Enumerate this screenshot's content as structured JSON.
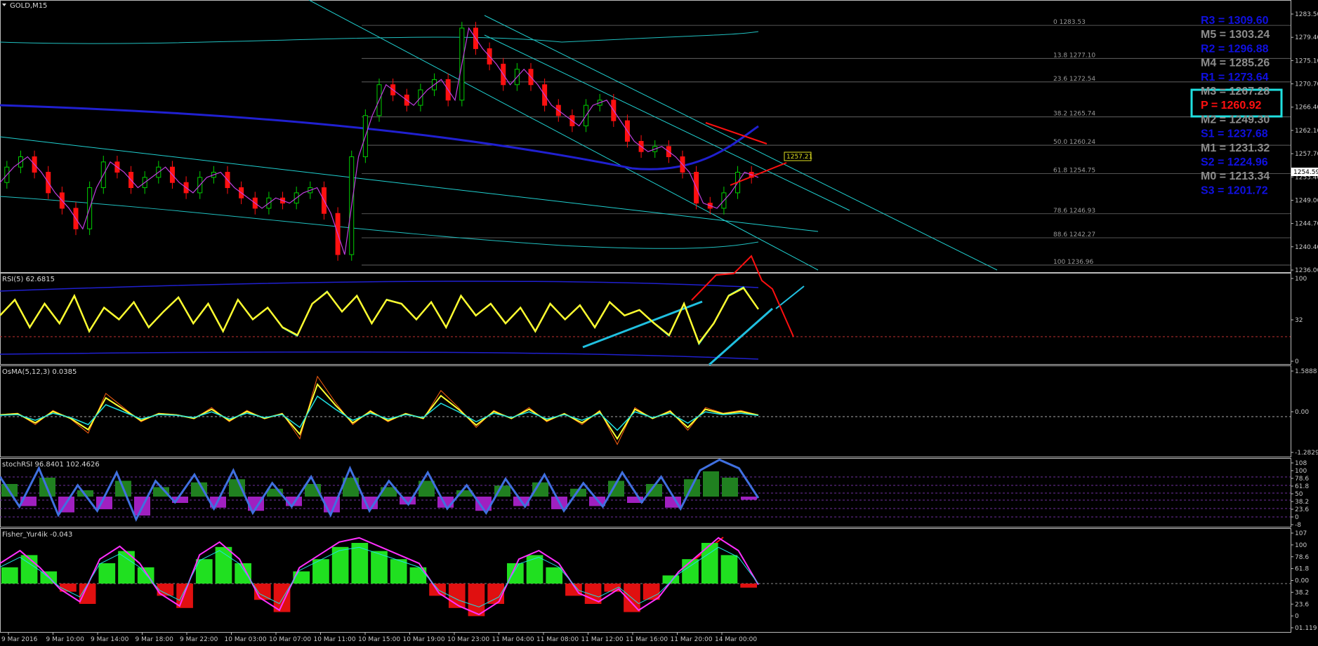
{
  "window": {
    "symbol_title": "GOLD,M15"
  },
  "chart_data": [
    {
      "type": "line",
      "name_label": "GOLD,M15",
      "ylim": [
        1236.0,
        1286.0
      ],
      "y_ticks": [
        "1283.50",
        "1279.40",
        "1275.10",
        "1270.70",
        "1266.40",
        "1262.10",
        "1257.70",
        "1253.40",
        "1249.00",
        "1244.70",
        "1240.40",
        "1236.00"
      ],
      "current_price": "1254.59",
      "price_tag": "1257.21",
      "fib_levels": [
        {
          "label": "0 1283.53",
          "value": 1283.53
        },
        {
          "label": "13.8 1277.10",
          "value": 1277.1
        },
        {
          "label": "23.6 1272.54",
          "value": 1272.54
        },
        {
          "label": "38.2 1265.74",
          "value": 1265.74
        },
        {
          "label": "50.0 1260.24",
          "value": 1260.24
        },
        {
          "label": "61.8 1254.75",
          "value": 1254.75
        },
        {
          "label": "78.6 1246.93",
          "value": 1246.93
        },
        {
          "label": "88.6 1242.27",
          "value": 1242.27
        },
        {
          "label": "100 1236.96",
          "value": 1236.96
        }
      ],
      "price_path": [
        1253,
        1256,
        1258,
        1255,
        1251,
        1248,
        1244,
        1252,
        1257,
        1255,
        1252,
        1254,
        1256,
        1253,
        1251,
        1254,
        1255,
        1252,
        1250,
        1248,
        1250,
        1249,
        1251,
        1252,
        1247,
        1239,
        1258,
        1266,
        1272,
        1270,
        1268,
        1271,
        1273,
        1269,
        1283,
        1279,
        1276,
        1272,
        1275,
        1272,
        1268,
        1266,
        1264,
        1268,
        1269,
        1265,
        1261,
        1259,
        1260,
        1258,
        1255,
        1249,
        1248,
        1251,
        1255,
        1254
      ],
      "pivots": [
        {
          "text": "R3 = 1309.60",
          "color": "#1010e0"
        },
        {
          "text": "M5 = 1303.24",
          "color": "#8c8c8c"
        },
        {
          "text": "R2 = 1296.88",
          "color": "#1010e0"
        },
        {
          "text": "M4 = 1285.26",
          "color": "#8c8c8c"
        },
        {
          "text": "R1 = 1273.64",
          "color": "#1010e0"
        },
        {
          "text": "M3 = 1267.28",
          "color": "#8c8c8c"
        },
        {
          "text": "P  = 1260.92",
          "color": "#ff1010"
        },
        {
          "text": "M2 = 1249.30",
          "color": "#8c8c8c"
        },
        {
          "text": "S1 = 1237.68",
          "color": "#1010e0"
        },
        {
          "text": "M1 = 1231.32",
          "color": "#8c8c8c"
        },
        {
          "text": "S2 = 1224.96",
          "color": "#1010e0"
        },
        {
          "text": "M0 = 1213.34",
          "color": "#8c8c8c"
        },
        {
          "text": "S3 = 1201.72",
          "color": "#1010e0"
        }
      ]
    },
    {
      "type": "line",
      "name_label": "RSI(5) 62.6815",
      "y_ticks": [
        "100",
        "32",
        "0"
      ],
      "ylim": [
        0,
        100
      ],
      "level": 32,
      "values": [
        55,
        75,
        40,
        70,
        45,
        80,
        35,
        65,
        50,
        72,
        40,
        60,
        78,
        45,
        70,
        35,
        75,
        50,
        65,
        40,
        30,
        70,
        85,
        60,
        80,
        45,
        75,
        70,
        50,
        72,
        40,
        80,
        55,
        70,
        45,
        65,
        35,
        70,
        50,
        68,
        40,
        72,
        55,
        62,
        45,
        30,
        70,
        20,
        45,
        80,
        90,
        63
      ]
    },
    {
      "type": "line",
      "name_label": "OsMA(5,12,3) 0.0385",
      "y_ticks": [
        "1.5888",
        "0.00",
        "-1.2829"
      ],
      "ylim": [
        -1.2829,
        1.5888
      ],
      "values": [
        0.05,
        0.1,
        -0.3,
        0.2,
        -0.1,
        -0.6,
        0.8,
        0.3,
        -0.2,
        0.1,
        0.05,
        -0.1,
        0.3,
        -0.2,
        0.2,
        -0.1,
        0.1,
        -0.8,
        1.4,
        0.5,
        -0.3,
        0.2,
        -0.2,
        0.1,
        -0.1,
        0.9,
        0.3,
        -0.4,
        0.2,
        -0.1,
        0.3,
        -0.2,
        0.1,
        -0.3,
        0.2,
        -1.0,
        0.3,
        -0.1,
        0.2,
        -0.5,
        0.3,
        0.1,
        0.2,
        0.04
      ]
    },
    {
      "type": "bar",
      "name_label": "stochRSI 96.8401 102.4626",
      "y_ticks": [
        "108",
        "100",
        "78.6",
        "61.8",
        "50",
        "38.2",
        "23.6",
        "0",
        "-8"
      ],
      "ylim": [
        -8,
        108
      ],
      "values": [
        40,
        -30,
        60,
        -50,
        20,
        -40,
        50,
        -60,
        30,
        -20,
        45,
        -35,
        55,
        -45,
        25,
        -30,
        40,
        -50,
        60,
        -40,
        30,
        -25,
        50,
        -35,
        20,
        -45,
        35,
        -30,
        45,
        -40,
        25,
        -30,
        50,
        -20,
        40,
        -35,
        55,
        80,
        60,
        -10
      ]
    },
    {
      "type": "bar",
      "name_label": "Fisher_Yur4ik -0.043",
      "y_ticks": [
        "107",
        "100",
        "78.6",
        "61.8",
        "0.00",
        "38.2",
        "23.6",
        "0",
        "01.119"
      ],
      "ylim": [
        -1,
        1
      ],
      "values": [
        0.4,
        0.7,
        0.3,
        -0.2,
        -0.5,
        0.5,
        0.8,
        0.4,
        -0.3,
        -0.6,
        0.6,
        0.9,
        0.5,
        -0.4,
        -0.7,
        0.3,
        0.6,
        0.9,
        1.0,
        0.8,
        0.6,
        0.4,
        -0.3,
        -0.6,
        -0.8,
        -0.5,
        0.5,
        0.7,
        0.4,
        -0.3,
        -0.5,
        -0.2,
        -0.7,
        -0.4,
        0.2,
        0.6,
        1.0,
        0.7,
        -0.1
      ]
    }
  ],
  "time_axis": [
    "9 Mar 2016",
    "9 Mar 10:00",
    "9 Mar 14:00",
    "9 Mar 18:00",
    "9 Mar 22:00",
    "10 Mar 03:00",
    "10 Mar 07:00",
    "10 Mar 11:00",
    "10 Mar 15:00",
    "10 Mar 19:00",
    "10 Mar 23:00",
    "11 Mar 04:00",
    "11 Mar 08:00",
    "11 Mar 12:00",
    "11 Mar 16:00",
    "11 Mar 20:00",
    "14 Mar 00:00"
  ],
  "colors": {
    "background": "#000000",
    "price_up": "#00d000",
    "price_down": "#ff1010",
    "rsi": "#ffff30",
    "ma_cyan": "#20e0e0",
    "bands": "#2020d0",
    "pivot_box": "#20e0e0",
    "fisher_up": "#20e020",
    "fisher_down": "#e01010",
    "stoch_line": "#4070e0",
    "stoch_up": "#208020",
    "stoch_down": "#a020c0"
  }
}
